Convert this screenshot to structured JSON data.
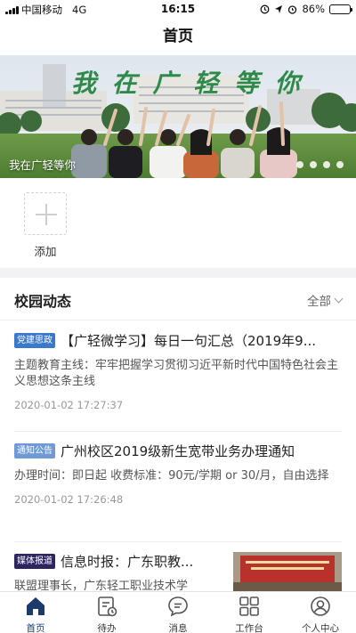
{
  "status_bar": {
    "carrier": "中国移动",
    "network": "4G",
    "time": "16:15",
    "battery": "86%",
    "battery_level": 0.86
  },
  "nav": {
    "title": "首页"
  },
  "banner": {
    "headline": "我 在 广 轻 等 你",
    "caption": "我在广轻等你",
    "dot_count": 4
  },
  "quick_actions": {
    "add_label": "添加"
  },
  "news": {
    "title": "校园动态",
    "filter_label": "全部",
    "items": [
      {
        "badge": "党建思政",
        "badge_color": "#3a78c9",
        "title": "【广轻微学习】每日一句汇总（2019年9...",
        "desc": "主题教育主线：牢牢把握学习贯彻习近平新时代中国特色社会主义思想这条主线",
        "date": "2020-01-02 17:27:37"
      },
      {
        "badge": "通知公告",
        "badge_color": "#6f9ad6",
        "title": "广州校区2019级新生宽带业务办理通知",
        "desc": "办理时间：即日起 收费标准：90元/学期 or 30/月，自由选择",
        "date": "2020-01-02 17:26:48"
      },
      {
        "badge": "媒体报道",
        "badge_color": "#2d2560",
        "title": "信息时报：广东职教...",
        "desc": "联盟理事长，广东轻工职业技术学"
      }
    ]
  },
  "tabbar": {
    "tabs": [
      {
        "label": "首页",
        "icon": "home-icon"
      },
      {
        "label": "待办",
        "icon": "todo-icon"
      },
      {
        "label": "消息",
        "icon": "message-icon"
      },
      {
        "label": "工作台",
        "icon": "workbench-icon"
      },
      {
        "label": "个人中心",
        "icon": "user-icon"
      }
    ],
    "active_color": "#1c3a6b"
  }
}
